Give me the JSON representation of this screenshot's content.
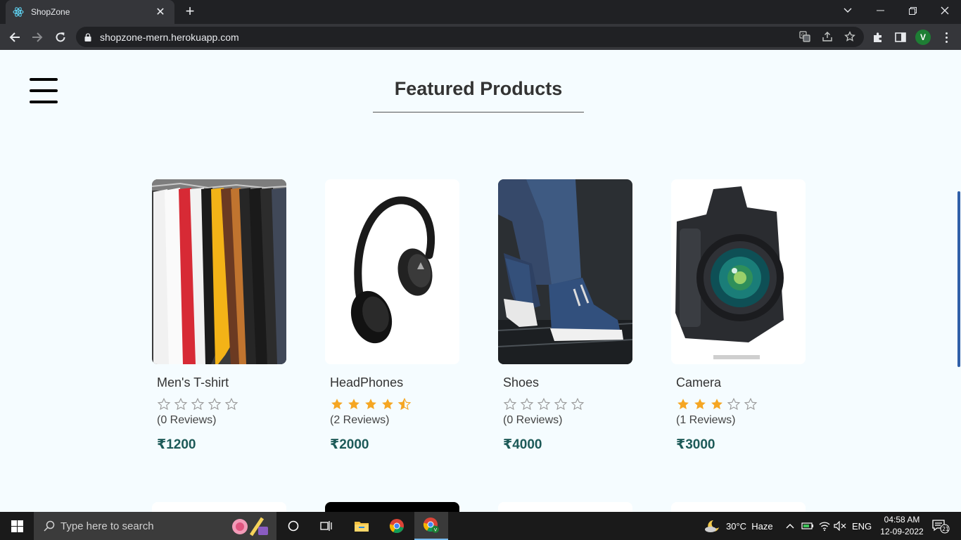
{
  "browser": {
    "tab_title": "ShopZone",
    "url": "shopzone-mern.herokuapp.com",
    "profile_initial": "V"
  },
  "page": {
    "heading": "Featured Products",
    "currency_symbol": "₹",
    "products": [
      {
        "name": "Men's T-shirt",
        "rating": 0,
        "reviews": "(0 Reviews)",
        "price": "₹1200"
      },
      {
        "name": "HeadPhones",
        "rating": 4.5,
        "reviews": "(2 Reviews)",
        "price": "₹2000"
      },
      {
        "name": "Shoes",
        "rating": 0,
        "reviews": "(0 Reviews)",
        "price": "₹4000"
      },
      {
        "name": "Camera",
        "rating": 3,
        "reviews": "(1 Reviews)",
        "price": "₹3000"
      }
    ],
    "colors": {
      "star_filled": "#f5a623",
      "star_empty": "#9a9a9a",
      "price": "#1d5a58",
      "background": "#f5fcff"
    }
  },
  "taskbar": {
    "search_placeholder": "Type here to search",
    "weather": "30°C  Haze",
    "language": "ENG",
    "time": "04:58 AM",
    "date": "12-09-2022",
    "notification_count": "21"
  }
}
